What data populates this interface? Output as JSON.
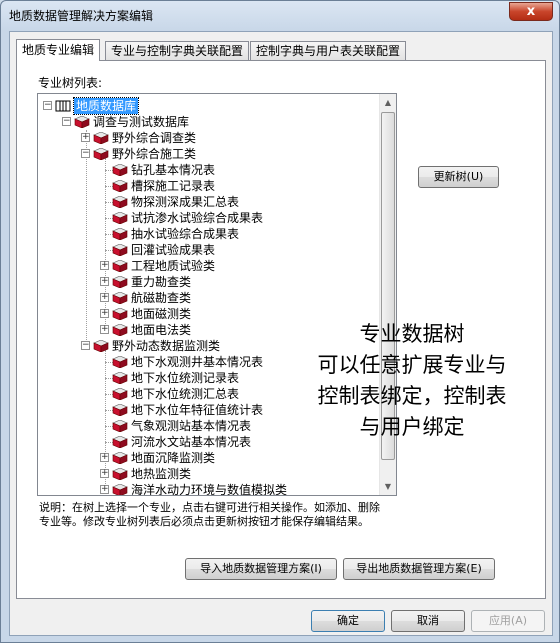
{
  "window": {
    "title": "地质数据管理解决方案编辑",
    "close_glyph": "x"
  },
  "tabs": [
    {
      "label": "地质专业编辑",
      "active": true
    },
    {
      "label": "专业与控制字典关联配置",
      "active": false
    },
    {
      "label": "控制字典与用户表关联配置",
      "active": false
    }
  ],
  "tree": {
    "label": "专业树列表:",
    "root": "地质数据库",
    "nodes": [
      {
        "level": 1,
        "label": "调查与测试数据库",
        "expander": "minus"
      },
      {
        "level": 2,
        "label": "野外综合调查类",
        "expander": "plus"
      },
      {
        "level": 2,
        "label": "野外综合施工类",
        "expander": "minus"
      },
      {
        "level": 3,
        "label": "钻孔基本情况表",
        "expander": "none"
      },
      {
        "level": 3,
        "label": "槽探施工记录表",
        "expander": "none"
      },
      {
        "level": 3,
        "label": "物探测深成果汇总表",
        "expander": "none"
      },
      {
        "level": 3,
        "label": "试抗渗水试验综合成果表",
        "expander": "none"
      },
      {
        "level": 3,
        "label": "抽水试验综合成果表",
        "expander": "none"
      },
      {
        "level": 3,
        "label": "回灌试验成果表",
        "expander": "none"
      },
      {
        "level": 3,
        "label": "工程地质试验类",
        "expander": "plus"
      },
      {
        "level": 3,
        "label": "重力勘查类",
        "expander": "plus"
      },
      {
        "level": 3,
        "label": "航磁勘查类",
        "expander": "plus"
      },
      {
        "level": 3,
        "label": "地面磁测类",
        "expander": "plus"
      },
      {
        "level": 3,
        "label": "地面电法类",
        "expander": "plus"
      },
      {
        "level": 2,
        "label": "野外动态数据监测类",
        "expander": "minus"
      },
      {
        "level": 3,
        "label": "地下水观测井基本情况表",
        "expander": "none"
      },
      {
        "level": 3,
        "label": "地下水位统测记录表",
        "expander": "none"
      },
      {
        "level": 3,
        "label": "地下水位统测汇总表",
        "expander": "none"
      },
      {
        "level": 3,
        "label": "地下水位年特征值统计表",
        "expander": "none"
      },
      {
        "level": 3,
        "label": "气象观测站基本情况表",
        "expander": "none"
      },
      {
        "level": 3,
        "label": "河流水文站基本情况表",
        "expander": "none"
      },
      {
        "level": 3,
        "label": "地面沉降监测类",
        "expander": "plus"
      },
      {
        "level": 3,
        "label": "地热监测类",
        "expander": "plus"
      },
      {
        "level": 3,
        "label": "海洋水动力环境与数值模拟类",
        "expander": "plus"
      }
    ]
  },
  "buttons": {
    "refresh_tree": "更新树(U)",
    "import_plan": "导入地质数据管理方案(I)",
    "export_plan": "导出地质数据管理方案(E)",
    "ok": "确定",
    "cancel": "取消",
    "apply": "应用(A)"
  },
  "overlay_lines": [
    "专业数据树",
    "可以任意扩展专业与",
    "控制表绑定，控制表",
    "与用户绑定"
  ],
  "description_lines": [
    "说明：在树上选择一个专业，点击右键可进行相关操作。如添加、删除",
    "专业等。修改专业树列表后必须点击更新树按钮才能保存编辑结果。"
  ],
  "colors": {
    "selection": "#3399ff",
    "book_red": "#c8102e"
  },
  "icons": {
    "root": "database-book-icon",
    "node": "red-book-icon"
  }
}
